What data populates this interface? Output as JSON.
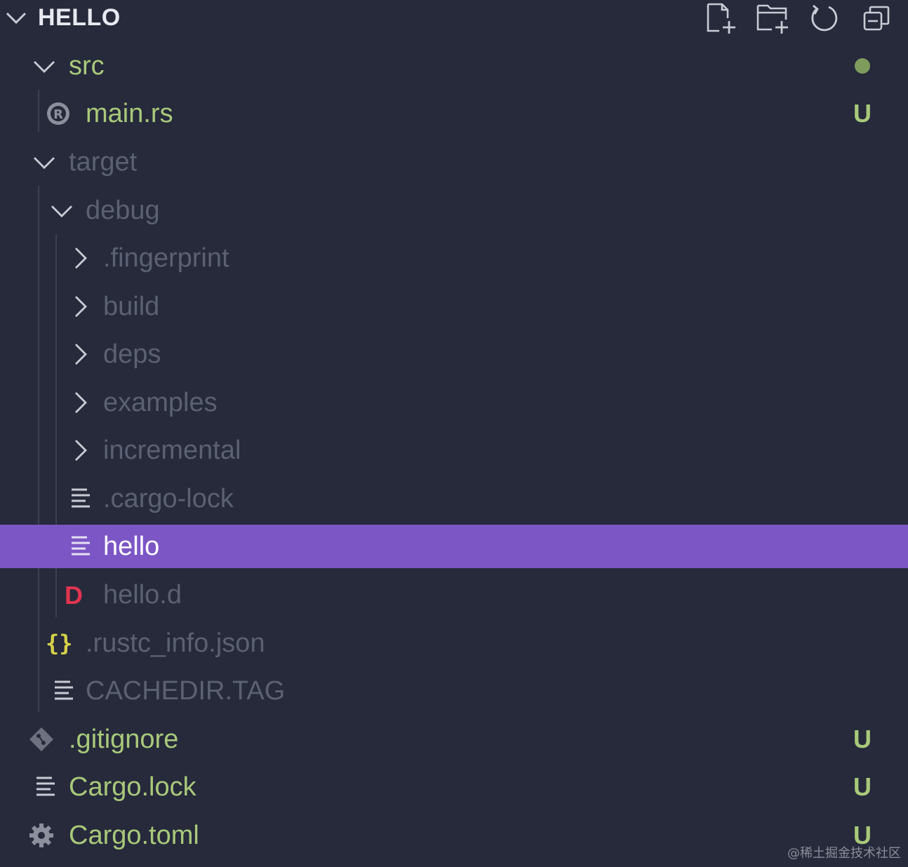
{
  "explorer": {
    "title": "HELLO",
    "actions": [
      {
        "name": "new-file-icon",
        "label": "New File"
      },
      {
        "name": "new-folder-icon",
        "label": "New Folder"
      },
      {
        "name": "refresh-icon",
        "label": "Refresh Explorer"
      },
      {
        "name": "collapse-all-icon",
        "label": "Collapse Folders in Explorer"
      }
    ],
    "items": [
      {
        "label": "src",
        "kind": "folder",
        "expanded": true,
        "status_dot": true
      },
      {
        "label": "main.rs",
        "kind": "rust-file",
        "status": "U"
      },
      {
        "label": "target",
        "kind": "folder",
        "expanded": true
      },
      {
        "label": "debug",
        "kind": "folder",
        "expanded": true
      },
      {
        "label": ".fingerprint",
        "kind": "folder",
        "expanded": false
      },
      {
        "label": "build",
        "kind": "folder",
        "expanded": false
      },
      {
        "label": "deps",
        "kind": "folder",
        "expanded": false
      },
      {
        "label": "examples",
        "kind": "folder",
        "expanded": false
      },
      {
        "label": "incremental",
        "kind": "folder",
        "expanded": false
      },
      {
        "label": ".cargo-lock",
        "kind": "text-file"
      },
      {
        "label": "hello",
        "kind": "text-file",
        "selected": true
      },
      {
        "label": "hello.d",
        "kind": "d-file"
      },
      {
        "label": ".rustc_info.json",
        "kind": "json-file"
      },
      {
        "label": "CACHEDIR.TAG",
        "kind": "text-file"
      },
      {
        "label": ".gitignore",
        "kind": "git-file",
        "status": "U"
      },
      {
        "label": "Cargo.lock",
        "kind": "text-file",
        "status": "U"
      },
      {
        "label": "Cargo.toml",
        "kind": "gear-file",
        "status": "U"
      }
    ]
  },
  "watermark": "@稀土掘金技术社区",
  "colors": {
    "background": "#262a3b",
    "selection": "#7c56c5",
    "untracked_text": "#a9c97a",
    "ignored_text": "#5b6172",
    "d_icon": "#e0344e",
    "json_icon": "#d8d24a"
  }
}
